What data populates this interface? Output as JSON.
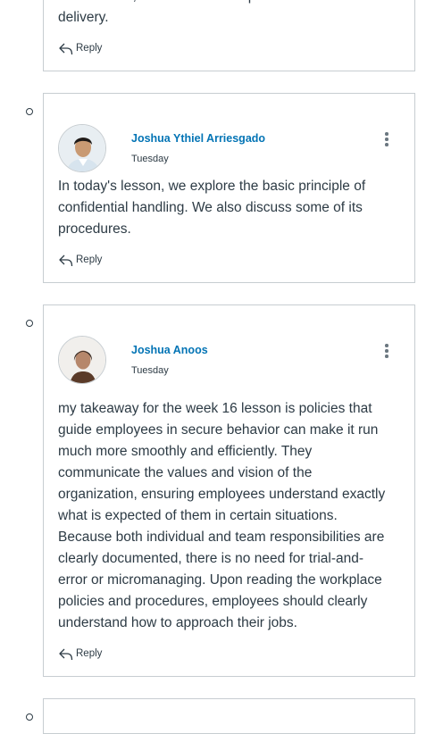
{
  "posts": [
    {
      "body": "for business, like email for companies and address for\ndelivery.",
      "reply_label": "Reply"
    },
    {
      "author": "Joshua Ythiel Arriesgado",
      "date": "Tuesday",
      "body": "In today's lesson, we explore the basic principle of\nconfidential handling. We also discuss some of its\nprocedures.",
      "reply_label": "Reply"
    },
    {
      "author": "Joshua Anoos",
      "date": "Tuesday",
      "body": "my takeaway for the week 16 lesson is policies that\nguide employees in secure behavior can make it run\nmuch more smoothly and efficiently. They\ncommunicate the values and vision of the\norganization, ensuring employees understand exactly\nwhat is expected of them in certain situations.\nBecause both individual and team responsibilities are\nclearly documented, there is no need for trial-and-\nerror or micromanaging. Upon reading the workplace\npolicies and procedures, employees should clearly\nunderstand how to approach their jobs.",
      "reply_label": "Reply"
    }
  ],
  "icons": {
    "reply": "reply-arrow-icon",
    "more": "kebab-menu-icon",
    "bullet": "hollow-circle-icon"
  },
  "colors": {
    "author_link": "#0374b5",
    "text": "#2d3b45",
    "border": "#c7cdd1"
  }
}
